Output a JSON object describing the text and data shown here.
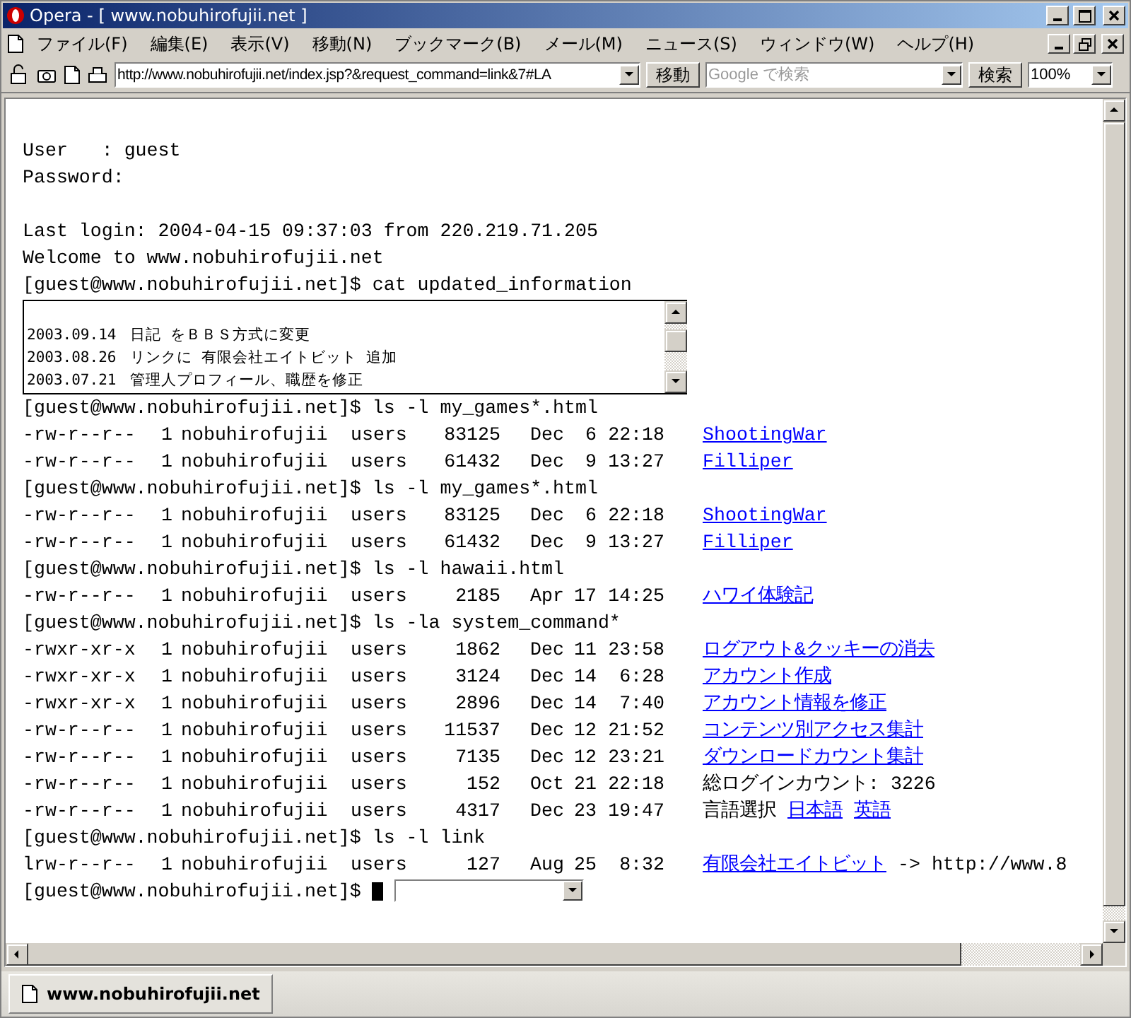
{
  "window": {
    "title": "Opera - [ www.nobuhirofujii.net ]"
  },
  "menu": [
    {
      "label": "ファイル(F)"
    },
    {
      "label": "編集(E)"
    },
    {
      "label": "表示(V)"
    },
    {
      "label": "移動(N)"
    },
    {
      "label": "ブックマーク(B)"
    },
    {
      "label": "メール(M)"
    },
    {
      "label": "ニュース(S)"
    },
    {
      "label": "ウィンドウ(W)"
    },
    {
      "label": "ヘルプ(H)"
    }
  ],
  "toolbar": {
    "address": "http://www.nobuhirofujii.net/index.jsp?&request_command=link&7#LA",
    "go_button": "移動",
    "search": {
      "placeholder": "Google で検索"
    },
    "search_button": "検索",
    "zoom": "100%"
  },
  "terminal": {
    "lines": [
      {
        "kind": "blank"
      },
      {
        "kind": "text",
        "text": "User   : guest"
      },
      {
        "kind": "text",
        "text": "Password:"
      },
      {
        "kind": "blank"
      },
      {
        "kind": "text",
        "text": "Last login: 2004-04-15 09:37:03 from 220.219.71.205"
      },
      {
        "kind": "text",
        "text": "Welcome to www.nobuhirofujii.net"
      },
      {
        "kind": "text",
        "text": "[guest@www.nobuhirofujii.net]$ cat updated_information"
      },
      {
        "kind": "news",
        "items": [
          {
            "date": "2003.09.14",
            "text": "日記 をＢＢＳ方式に変更"
          },
          {
            "date": "2003.08.26",
            "text": "リンクに 有限会社エイトビット 追加"
          },
          {
            "date": "2003.07.21",
            "text": "管理人プロフィール、職歴を修正"
          }
        ]
      },
      {
        "kind": "text",
        "text": "[guest@www.nobuhirofujii.net]$ ls -l my_games*.html"
      },
      {
        "kind": "file",
        "perms": "-rw-r--r--",
        "links": "1",
        "owner": "nobuhirofujii",
        "group": "users",
        "size": "83125",
        "month": "Dec",
        "day": "6",
        "time": "22:18",
        "name": [
          {
            "kind": "link",
            "text": "ShootingWar"
          }
        ]
      },
      {
        "kind": "file",
        "perms": "-rw-r--r--",
        "links": "1",
        "owner": "nobuhirofujii",
        "group": "users",
        "size": "61432",
        "month": "Dec",
        "day": "9",
        "time": "13:27",
        "name": [
          {
            "kind": "link",
            "text": "Filliper"
          }
        ]
      },
      {
        "kind": "text",
        "text": "[guest@www.nobuhirofujii.net]$ ls -l my_games*.html"
      },
      {
        "kind": "file",
        "perms": "-rw-r--r--",
        "links": "1",
        "owner": "nobuhirofujii",
        "group": "users",
        "size": "83125",
        "month": "Dec",
        "day": "6",
        "time": "22:18",
        "name": [
          {
            "kind": "link",
            "text": "ShootingWar"
          }
        ]
      },
      {
        "kind": "file",
        "perms": "-rw-r--r--",
        "links": "1",
        "owner": "nobuhirofujii",
        "group": "users",
        "size": "61432",
        "month": "Dec",
        "day": "9",
        "time": "13:27",
        "name": [
          {
            "kind": "link",
            "text": "Filliper"
          }
        ]
      },
      {
        "kind": "text",
        "text": "[guest@www.nobuhirofujii.net]$ ls -l hawaii.html"
      },
      {
        "kind": "file",
        "perms": "-rw-r--r--",
        "links": "1",
        "owner": "nobuhirofujii",
        "group": "users",
        "size": "2185",
        "month": "Apr",
        "day": "17",
        "time": "14:25",
        "name": [
          {
            "kind": "link",
            "text": "ハワイ体験記"
          }
        ]
      },
      {
        "kind": "text",
        "text": "[guest@www.nobuhirofujii.net]$ ls -la system_command*"
      },
      {
        "kind": "file",
        "perms": "-rwxr-xr-x",
        "links": "1",
        "owner": "nobuhirofujii",
        "group": "users",
        "size": "1862",
        "month": "Dec",
        "day": "11",
        "time": "23:58",
        "name": [
          {
            "kind": "link",
            "text": "ログアウト&クッキーの消去"
          }
        ]
      },
      {
        "kind": "file",
        "perms": "-rwxr-xr-x",
        "links": "1",
        "owner": "nobuhirofujii",
        "group": "users",
        "size": "3124",
        "month": "Dec",
        "day": "14",
        "time": "6:28",
        "name": [
          {
            "kind": "link",
            "text": "アカウント作成"
          }
        ]
      },
      {
        "kind": "file",
        "perms": "-rwxr-xr-x",
        "links": "1",
        "owner": "nobuhirofujii",
        "group": "users",
        "size": "2896",
        "month": "Dec",
        "day": "14",
        "time": "7:40",
        "name": [
          {
            "kind": "link",
            "text": "アカウント情報を修正"
          }
        ]
      },
      {
        "kind": "file",
        "perms": "-rw-r--r--",
        "links": "1",
        "owner": "nobuhirofujii",
        "group": "users",
        "size": "11537",
        "month": "Dec",
        "day": "12",
        "time": "21:52",
        "name": [
          {
            "kind": "link",
            "text": "コンテンツ別アクセス集計"
          }
        ]
      },
      {
        "kind": "file",
        "perms": "-rw-r--r--",
        "links": "1",
        "owner": "nobuhirofujii",
        "group": "users",
        "size": "7135",
        "month": "Dec",
        "day": "12",
        "time": "23:21",
        "name": [
          {
            "kind": "link",
            "text": "ダウンロードカウント集計"
          }
        ]
      },
      {
        "kind": "file",
        "perms": "-rw-r--r--",
        "links": "1",
        "owner": "nobuhirofujii",
        "group": "users",
        "size": "152",
        "month": "Oct",
        "day": "21",
        "time": "22:18",
        "name": [
          {
            "kind": "text",
            "text": "総ログインカウント: 3226"
          }
        ]
      },
      {
        "kind": "file",
        "perms": "-rw-r--r--",
        "links": "1",
        "owner": "nobuhirofujii",
        "group": "users",
        "size": "4317",
        "month": "Dec",
        "day": "23",
        "time": "19:47",
        "name": [
          {
            "kind": "text",
            "text": "言語選択"
          },
          {
            "kind": "link",
            "text": "日本語"
          },
          {
            "kind": "link",
            "text": "英語"
          }
        ]
      },
      {
        "kind": "text",
        "text": "[guest@www.nobuhirofujii.net]$ ls -l link"
      },
      {
        "kind": "file",
        "perms": "lrw-r--r--",
        "links": "1",
        "owner": "nobuhirofujii",
        "group": "users",
        "size": "127",
        "month": "Aug",
        "day": "25",
        "time": "8:32",
        "name": [
          {
            "kind": "link",
            "text": "有限会社エイトビット"
          },
          {
            "kind": "text",
            "text": "-> http://www.8"
          }
        ]
      },
      {
        "kind": "input",
        "prompt": "[guest@www.nobuhirofujii.net]$"
      }
    ]
  },
  "tabs": [
    {
      "label": "www.nobuhirofujii.net",
      "selected": true
    }
  ]
}
